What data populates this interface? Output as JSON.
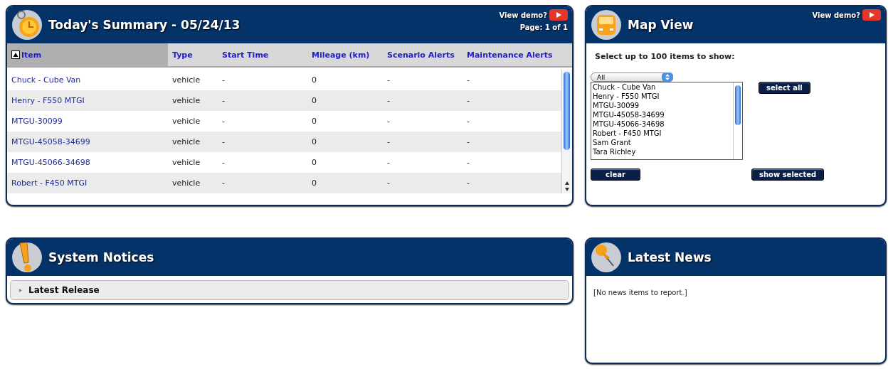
{
  "summary": {
    "title": "Today's Summary - 05/24/13",
    "demo_label": "View demo?",
    "page": "Page: 1 of 1",
    "columns": [
      {
        "label": "Item",
        "sorted": true
      },
      {
        "label": "Type",
        "sorted": false
      },
      {
        "label": "Start Time",
        "sorted": false
      },
      {
        "label": "Mileage (km)",
        "sorted": false
      },
      {
        "label": "Scenario Alerts",
        "sorted": false
      },
      {
        "label": "Maintenance Alerts",
        "sorted": false
      }
    ],
    "rows": [
      {
        "item": "Chuck - Cube Van",
        "type": "vehicle",
        "start_time": "-",
        "mileage": "0",
        "scenario_alerts": "-",
        "maintenance_alerts": "-"
      },
      {
        "item": "Henry - F550 MTGI",
        "type": "vehicle",
        "start_time": "-",
        "mileage": "0",
        "scenario_alerts": "-",
        "maintenance_alerts": "-"
      },
      {
        "item": "MTGU-30099",
        "type": "vehicle",
        "start_time": "-",
        "mileage": "0",
        "scenario_alerts": "-",
        "maintenance_alerts": "-"
      },
      {
        "item": "MTGU-45058-34699",
        "type": "vehicle",
        "start_time": "-",
        "mileage": "0",
        "scenario_alerts": "-",
        "maintenance_alerts": "-"
      },
      {
        "item": "MTGU-45066-34698",
        "type": "vehicle",
        "start_time": "-",
        "mileage": "0",
        "scenario_alerts": "-",
        "maintenance_alerts": "-"
      },
      {
        "item": "Robert - F450 MTGI",
        "type": "vehicle",
        "start_time": "-",
        "mileage": "0",
        "scenario_alerts": "-",
        "maintenance_alerts": "-"
      }
    ]
  },
  "map_view": {
    "title": "Map View",
    "demo_label": "View demo?",
    "instruction": "Select up to 100 items to show:",
    "filter": "All",
    "items": [
      {
        "label": "Chuck - Cube Van",
        "selected": false
      },
      {
        "label": "Henry - F550 MTGI",
        "selected": false
      },
      {
        "label": "MTGU-30099",
        "selected": false
      },
      {
        "label": "MTGU-45058-34699",
        "selected": false
      },
      {
        "label": "MTGU-45066-34698",
        "selected": false
      },
      {
        "label": "Robert - F450 MTGI",
        "selected": false
      },
      {
        "label": "Sam Grant",
        "selected": false
      },
      {
        "label": "Tara Richley",
        "selected": false
      }
    ],
    "select_all": "select all",
    "clear": "clear",
    "show_selected": "show selected"
  },
  "system_notices": {
    "title": "System Notices",
    "sections": [
      {
        "label": "Latest Release",
        "expanded": false
      }
    ]
  },
  "latest_news": {
    "title": "Latest News",
    "message": "[No news items to report.]"
  }
}
